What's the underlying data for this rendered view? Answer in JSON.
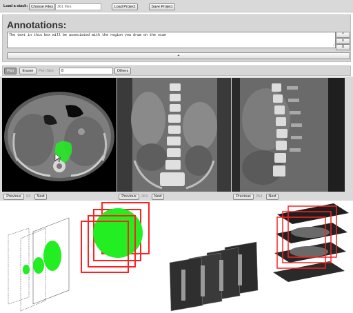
{
  "toolbar": {
    "load_stack_label": "Load a stack:",
    "choose_files_label": "Choose Files",
    "file_count_text": "361 files",
    "load_project_label": "Load Project",
    "save_project_label": "Save Project"
  },
  "annotations": {
    "title": "Annotations:",
    "text": "The text in this box will be associated with the region you draw on the scan",
    "side_buttons": [
      "^",
      "v",
      "X"
    ],
    "add_label": "+"
  },
  "tools": {
    "pan_label": "Pan",
    "eraser_label": "Eraser",
    "pen_size_label": "Pen Size",
    "pen_size_value": "8",
    "others_label": "Others"
  },
  "viewers": [
    {
      "previous_label": "Previous",
      "slice": "53",
      "next_label": "Next"
    },
    {
      "previous_label": "Previous",
      "slice": "264",
      "next_label": "Next"
    },
    {
      "previous_label": "Previous",
      "slice": "264",
      "next_label": "Next"
    }
  ],
  "colors": {
    "panel_bg": "#d9d9d9",
    "mask_green": "#22ee22",
    "frame_red": "#ff2020"
  }
}
